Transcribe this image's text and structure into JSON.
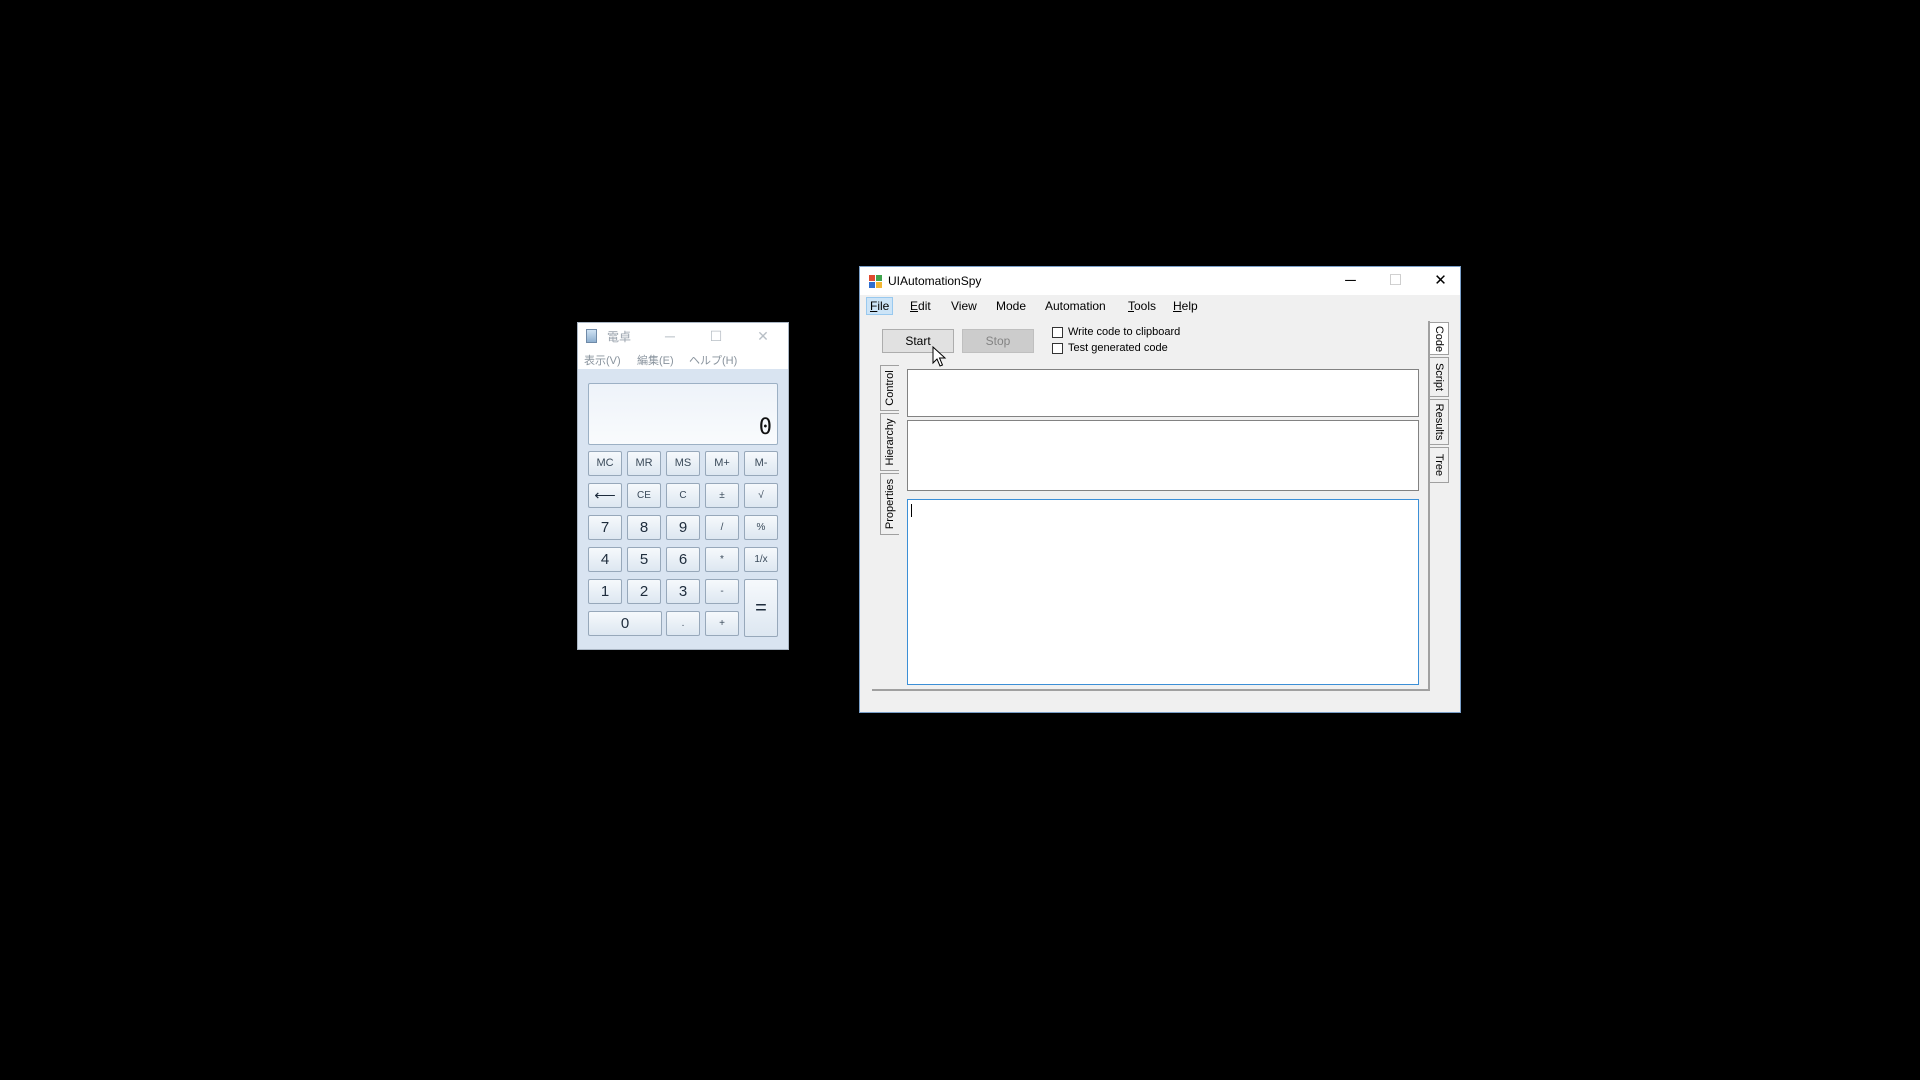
{
  "calculator": {
    "title": "電卓",
    "caption": {
      "minimize": "─",
      "maximize": "☐",
      "close": "✕"
    },
    "menu": [
      "表示(V)",
      "編集(E)",
      "ヘルプ(H)"
    ],
    "display": "0",
    "keys": {
      "mc": "MC",
      "mr": "MR",
      "ms": "MS",
      "mplus": "M+",
      "mminus": "M-",
      "back": "⟵",
      "ce": "CE",
      "c": "C",
      "plusminus": "±",
      "sqrt": "√",
      "d7": "7",
      "d8": "8",
      "d9": "9",
      "div": "/",
      "pct": "%",
      "d4": "4",
      "d5": "5",
      "d6": "6",
      "mul": "*",
      "recip": "1/x",
      "d1": "1",
      "d2": "2",
      "d3": "3",
      "sub": "-",
      "eq": "=",
      "d0": "0",
      "dot": ".",
      "add": "+"
    }
  },
  "spy": {
    "title": "UIAutomationSpy",
    "caption": {
      "minimize": "─",
      "maximize": "☐",
      "close": "✕"
    },
    "menu": {
      "file": {
        "hot": "F",
        "rest": "ile"
      },
      "edit": {
        "hot": "E",
        "rest": "dit"
      },
      "view": {
        "pre": "View"
      },
      "mode": {
        "pre": "Mode"
      },
      "automation": {
        "pre": "Automation"
      },
      "tools": {
        "hot": "T",
        "rest": "ools"
      },
      "help": {
        "hot": "H",
        "rest": "elp"
      }
    },
    "start_label": "Start",
    "stop_label": "Stop",
    "checkboxes": {
      "clipboard": {
        "label": "Write code to clipboard",
        "checked": false
      },
      "test": {
        "label": "Test generated code",
        "checked": false
      }
    },
    "left_tabs": {
      "control": "Control",
      "hierarchy": "Hierarchy",
      "properties": "Properties"
    },
    "right_tabs": {
      "code": "Code",
      "script": "Script",
      "results": "Results",
      "tree": "Tree"
    },
    "icon_colors": [
      "#e04a2f",
      "#3fa34d",
      "#2f6fd0",
      "#f2b632"
    ]
  }
}
